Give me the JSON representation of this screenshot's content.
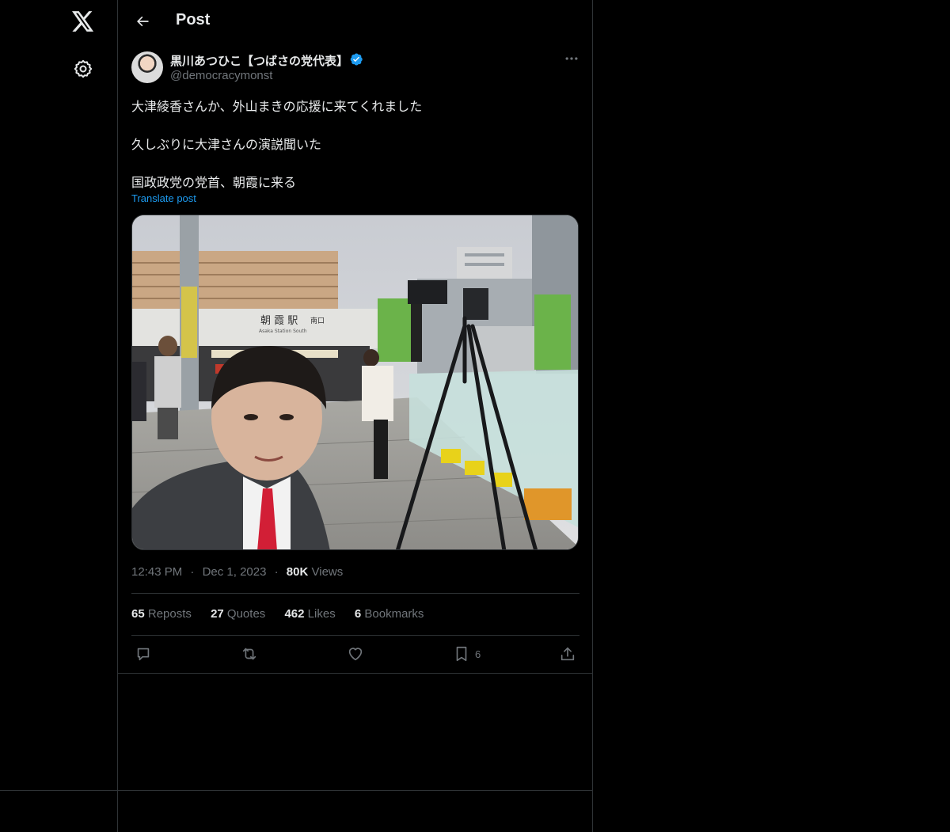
{
  "rail": {
    "logo_icon": "x-logo-icon",
    "settings_icon": "gear-icon"
  },
  "header": {
    "title": "Post",
    "back_icon": "arrow-left-icon"
  },
  "post": {
    "author": {
      "display_name": "黒川あつひこ【つばさの党代表】",
      "handle": "@democracymonst",
      "verified": true
    },
    "text_lines": [
      "大津綾香さんか、外山まきの応援に来てくれました",
      "久しぶりに大津さんの演説聞いた",
      "国政政党の党首、朝霞に来る"
    ],
    "translate_label": "Translate post",
    "image": {
      "sign_main": "朝 霞 駅",
      "sign_sub": "南口",
      "sign_romaji": "Asaka Station South"
    },
    "meta": {
      "time": "12:43 PM",
      "date": "Dec 1, 2023",
      "views_count": "80K",
      "views_label": "Views",
      "separator": "·"
    },
    "stats": {
      "reposts": {
        "count": "65",
        "label": "Reposts"
      },
      "quotes": {
        "count": "27",
        "label": "Quotes"
      },
      "likes": {
        "count": "462",
        "label": "Likes"
      },
      "bookmarks": {
        "count": "6",
        "label": "Bookmarks"
      }
    },
    "actions": {
      "reply_icon": "reply-icon",
      "repost_icon": "repost-icon",
      "like_icon": "heart-icon",
      "bookmark_icon": "bookmark-icon",
      "bookmark_count": "6",
      "share_icon": "share-icon"
    }
  },
  "colors": {
    "accent": "#1d9bf0",
    "background": "#000000",
    "border": "#2f3336",
    "muted": "#71767b",
    "text": "#e7e9ea"
  }
}
